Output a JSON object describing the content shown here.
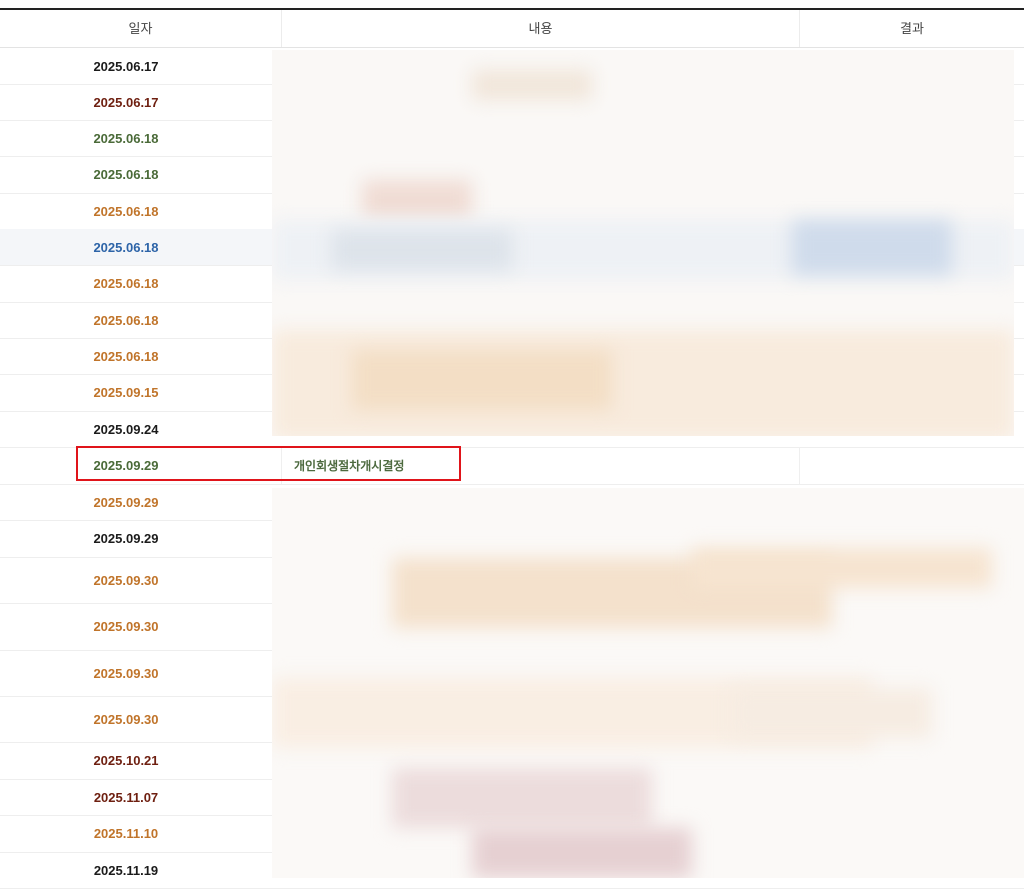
{
  "table": {
    "headers": {
      "date": "일자",
      "content": "내용",
      "result": "결과"
    },
    "rows": [
      {
        "date": "2025.06.17",
        "content": "",
        "color": "#1b1b1b"
      },
      {
        "date": "2025.06.17",
        "content": "",
        "color": "#6e1f10"
      },
      {
        "date": "2025.06.18",
        "content": "",
        "color": "#4a6a38"
      },
      {
        "date": "2025.06.18",
        "content": "",
        "color": "#4a6a38"
      },
      {
        "date": "2025.06.18",
        "content": "",
        "color": "#c0742a"
      },
      {
        "date": "2025.06.18",
        "content": "",
        "color": "#2d64a8"
      },
      {
        "date": "2025.06.18",
        "content": "",
        "color": "#c0742a"
      },
      {
        "date": "2025.06.18",
        "content": "",
        "color": "#c0742a"
      },
      {
        "date": "2025.06.18",
        "content": "",
        "color": "#c0742a"
      },
      {
        "date": "2025.09.15",
        "content": "",
        "color": "#c0742a"
      },
      {
        "date": "2025.09.24",
        "content": "",
        "color": "#1b1b1b"
      },
      {
        "date": "2025.09.29",
        "content": "개인회생절차개시결정",
        "color": "#4a6a38"
      },
      {
        "date": "2025.09.29",
        "content": "",
        "color": "#c0742a"
      },
      {
        "date": "2025.09.29",
        "content": "",
        "color": "#1b1b1b"
      },
      {
        "date": "2025.09.30",
        "content": "",
        "color": "#c0742a"
      },
      {
        "date": "2025.09.30",
        "content": "",
        "color": "#c0742a"
      },
      {
        "date": "2025.09.30",
        "content": "",
        "color": "#c0742a"
      },
      {
        "date": "2025.09.30",
        "content": "",
        "color": "#c0742a"
      },
      {
        "date": "2025.10.21",
        "content": "",
        "color": "#6e1f10"
      },
      {
        "date": "2025.11.07",
        "content": "",
        "color": "#6e1f10"
      },
      {
        "date": "2025.11.10",
        "content": "",
        "color": "#c0742a"
      },
      {
        "date": "2025.11.19",
        "content": "",
        "color": "#1b1b1b"
      }
    ]
  },
  "highlight_color": "#e0141a"
}
